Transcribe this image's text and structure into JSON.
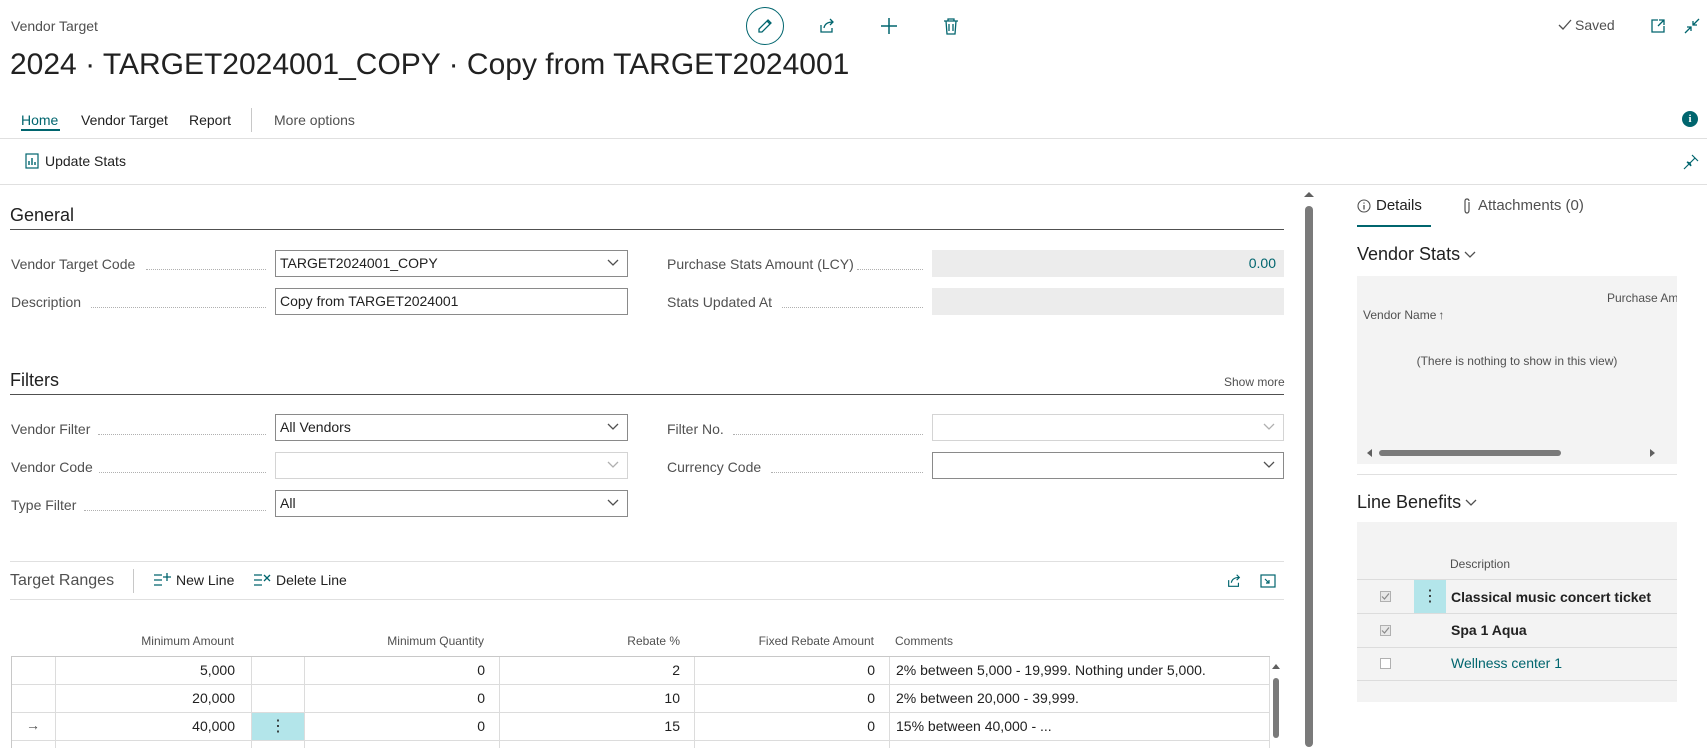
{
  "header": {
    "page_type": "Vendor Target",
    "title": "2024 · TARGET2024001_COPY · Copy from TARGET2024001",
    "saved_label": "Saved"
  },
  "tabs": [
    {
      "label": "Home"
    },
    {
      "label": "Vendor Target"
    },
    {
      "label": "Report"
    },
    {
      "label": "More options"
    }
  ],
  "actions": {
    "update_stats": "Update Stats"
  },
  "general": {
    "title": "General",
    "vendor_target_code_label": "Vendor Target Code",
    "vendor_target_code": "TARGET2024001_COPY",
    "description_label": "Description",
    "description": "Copy from TARGET2024001",
    "purchase_stats_label": "Purchase Stats Amount (LCY)",
    "purchase_stats": "0.00",
    "stats_updated_label": "Stats Updated At",
    "stats_updated": ""
  },
  "filters": {
    "title": "Filters",
    "show_more": "Show more",
    "vendor_filter_label": "Vendor Filter",
    "vendor_filter": "All Vendors",
    "vendor_code_label": "Vendor Code",
    "vendor_code": "",
    "type_filter_label": "Type Filter",
    "type_filter": "All",
    "filter_no_label": "Filter No.",
    "filter_no": "",
    "currency_code_label": "Currency Code",
    "currency_code": ""
  },
  "target_ranges": {
    "title": "Target Ranges",
    "new_line": "New Line",
    "delete_line": "Delete Line",
    "columns": [
      "Minimum Amount",
      "Minimum Quantity",
      "Rebate %",
      "Fixed Rebate Amount",
      "Comments"
    ],
    "rows": [
      {
        "min_amount": "5,000",
        "min_qty": "0",
        "rebate": "2",
        "fixed": "0",
        "comments": "2% between 5,000 - 19,999. Nothing under 5,000."
      },
      {
        "min_amount": "20,000",
        "min_qty": "0",
        "rebate": "10",
        "fixed": "0",
        "comments": "2% between 20,000 - 39,999."
      },
      {
        "min_amount": "40,000",
        "min_qty": "0",
        "rebate": "15",
        "fixed": "0",
        "comments": "15% between 40,000 - ..."
      }
    ]
  },
  "factbox": {
    "details_tab": "Details",
    "attachments_tab": "Attachments (0)",
    "vendor_stats": {
      "title": "Vendor Stats",
      "col_vendor_name": "Vendor Name",
      "col_purchase": "Purchase Am",
      "empty": "(There is nothing to show in this view)"
    },
    "line_benefits": {
      "title": "Line Benefits",
      "col_description": "Description",
      "items": [
        {
          "label": "Classical music concert ticket"
        },
        {
          "label": "Spa 1 Aqua"
        },
        {
          "label": "Wellness center 1"
        }
      ]
    }
  },
  "colors": {
    "accent": "#00656e",
    "teal_light": "#b3e5ea"
  }
}
